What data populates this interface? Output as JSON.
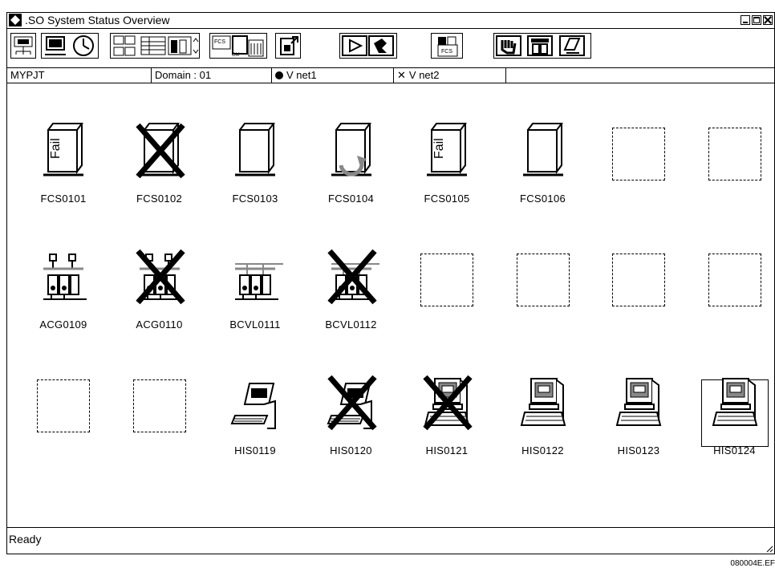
{
  "window": {
    "title": ".SO System Status Overview"
  },
  "info_bar": {
    "project": "MYPJT",
    "domain": "Domain : 01",
    "vnet1": "V net1",
    "vnet2": "V net2"
  },
  "toolbar": {
    "buttons": [
      "system-alarm-icon",
      "operator-guide-icon",
      "clock-icon",
      "system-config-icon",
      "table-view-icon",
      "status-display-icon",
      "fcs-status-icon",
      "monitor-icon",
      "download-icon",
      "play-icon",
      "stop-icon",
      "fcs-load-icon",
      "hand-icon",
      "cabinet-icon",
      "report-icon"
    ]
  },
  "stations": [
    {
      "label": "FCS0101",
      "type": "fcs",
      "status": "fail"
    },
    {
      "label": "FCS0102",
      "type": "fcs",
      "status": "down"
    },
    {
      "label": "FCS0103",
      "type": "fcs",
      "status": "normal"
    },
    {
      "label": "FCS0104",
      "type": "fcs",
      "status": "loading"
    },
    {
      "label": "FCS0105",
      "type": "fcs",
      "status": "fail"
    },
    {
      "label": "FCS0106",
      "type": "fcs",
      "status": "normal"
    },
    {
      "label": "",
      "type": "empty",
      "status": ""
    },
    {
      "label": "",
      "type": "empty",
      "status": ""
    },
    {
      "label": "ACG0109",
      "type": "acg",
      "status": "normal"
    },
    {
      "label": "ACG0110",
      "type": "acg",
      "status": "down"
    },
    {
      "label": "BCVL0111",
      "type": "bcv",
      "status": "normal"
    },
    {
      "label": "BCVL0112",
      "type": "bcv",
      "status": "down"
    },
    {
      "label": "",
      "type": "empty",
      "status": ""
    },
    {
      "label": "",
      "type": "empty",
      "status": ""
    },
    {
      "label": "",
      "type": "empty",
      "status": ""
    },
    {
      "label": "",
      "type": "empty",
      "status": ""
    },
    {
      "label": "",
      "type": "empty",
      "status": ""
    },
    {
      "label": "",
      "type": "empty",
      "status": ""
    },
    {
      "label": "HIS0119",
      "type": "his-console",
      "status": "normal"
    },
    {
      "label": "HIS0120",
      "type": "his-console",
      "status": "down"
    },
    {
      "label": "HIS0121",
      "type": "his-pc",
      "status": "down"
    },
    {
      "label": "HIS0122",
      "type": "his-pc",
      "status": "normal"
    },
    {
      "label": "HIS0123",
      "type": "his-pc",
      "status": "normal"
    },
    {
      "label": "HIS0124",
      "type": "his-pc",
      "status": "selected"
    }
  ],
  "fail_text": "Fail",
  "status_bar": {
    "text": "Ready"
  },
  "figure_code": "080004E.EF"
}
